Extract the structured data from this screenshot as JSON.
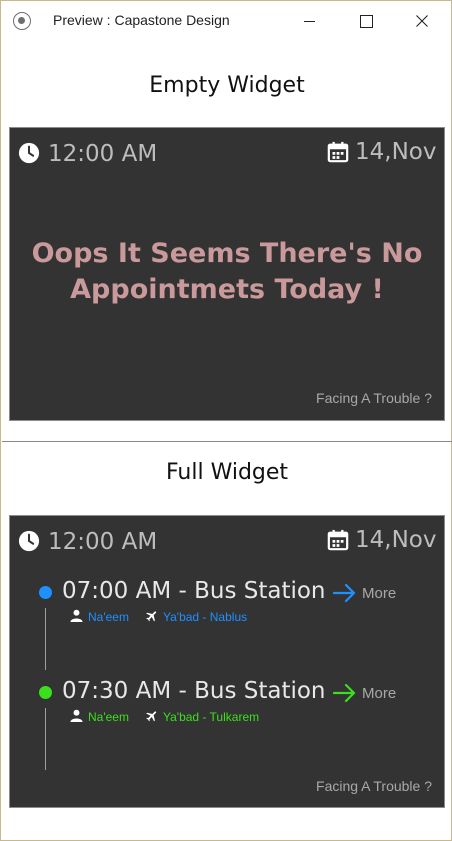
{
  "window": {
    "title": "Preview : Capastone Design"
  },
  "empty_widget": {
    "section_title": "Empty Widget",
    "time": "12:00 AM",
    "date": "14,Nov",
    "message_line1": "Oops It Seems There's No",
    "message_line2": "Appointmets Today !",
    "trouble_link": "Facing A Trouble ?"
  },
  "full_widget": {
    "section_title": "Full Widget",
    "time": "12:00 AM",
    "date": "14,Nov",
    "appointments": [
      {
        "title": "07:00 AM - Bus Station",
        "more_label": "More",
        "person": "Na'eem",
        "route": "Ya'bad - Nablus",
        "color": "#1e90ff"
      },
      {
        "title": "07:30 AM - Bus Station",
        "more_label": "More",
        "person": "Na'eem",
        "route": "Ya'bad - Tulkarem",
        "color": "#39e01b"
      }
    ],
    "trouble_link": "Facing A Trouble ?"
  },
  "icons": {
    "app": "app-icon",
    "minimize": "minimize-icon",
    "maximize": "maximize-icon",
    "close": "close-icon",
    "clock": "clock-icon",
    "calendar": "calendar-icon",
    "arrow": "arrow-right-icon",
    "person": "person-icon",
    "plane": "plane-icon"
  },
  "colors": {
    "widget_bg": "#333333",
    "message": "#c9999b",
    "muted_text": "#bdbdbd"
  }
}
